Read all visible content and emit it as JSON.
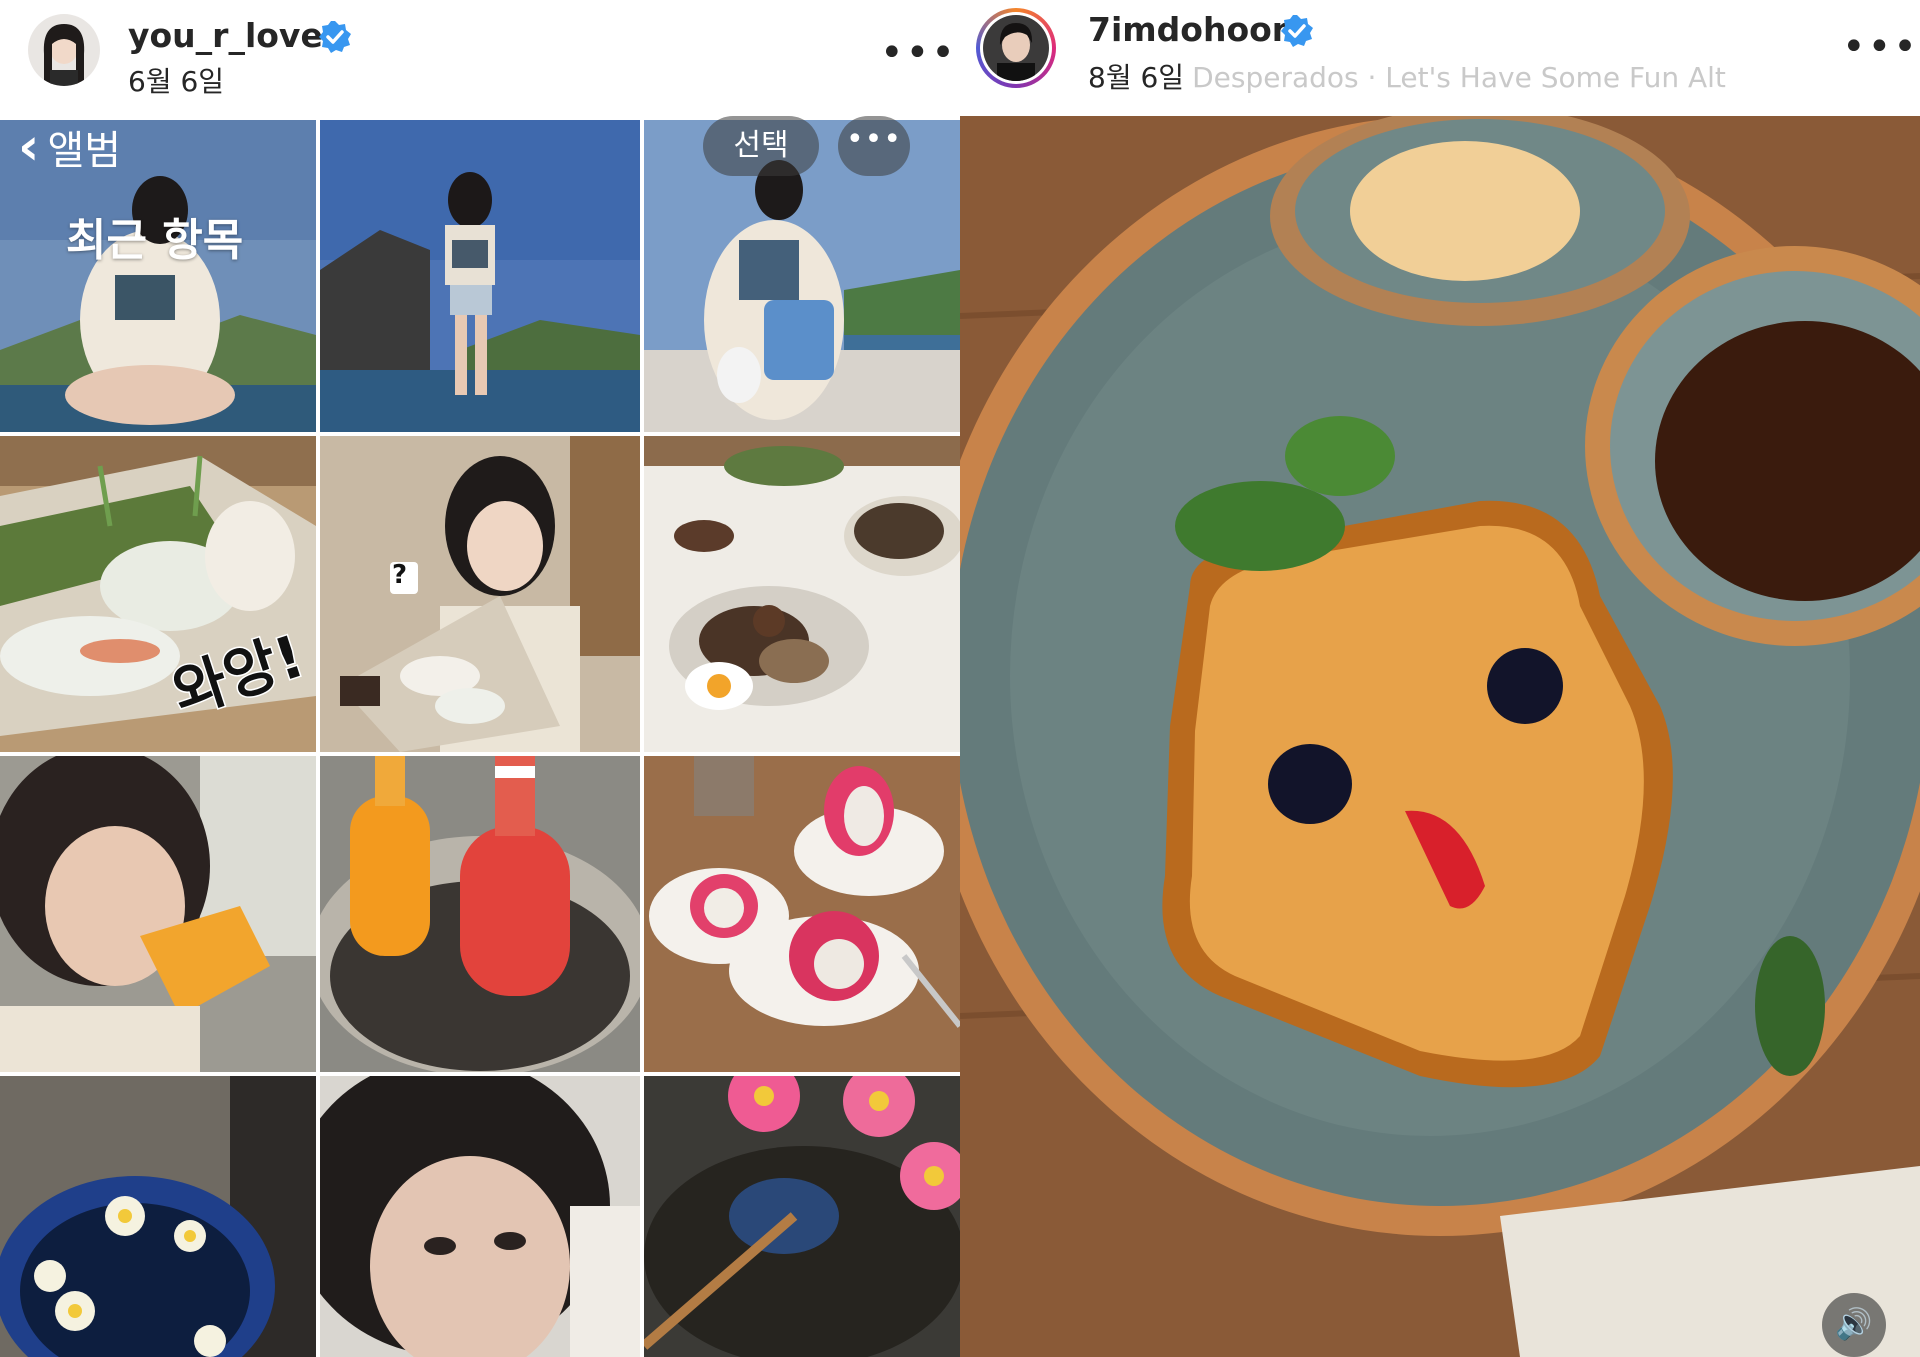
{
  "left_post": {
    "username": "you_r_love",
    "verified_icon": "verified-badge-icon",
    "date": "6월 6일",
    "more_label": "•••",
    "album": {
      "back_label": "앨범",
      "title": "최근 항목",
      "select_label": "선택",
      "more_label": "•••"
    },
    "sticker_text": "와앙!",
    "photos": [
      "pose-by-pool",
      "standing-by-pool",
      "sitting-with-bag",
      "spring-rolls",
      "girl-with-rolls",
      "dinner-table",
      "eating-mango",
      "juice-bottles",
      "dragon-fruit",
      "flower-bowl",
      "selfie-close",
      "flowers-pond"
    ]
  },
  "right_post": {
    "username": "7imdohoon",
    "verified_icon": "verified-badge-icon",
    "date": "8월 6일",
    "music": "Desperados · Let's Have Some Fun Alt",
    "more_label": "•••",
    "sound_icon": "speaker-icon",
    "sound_label": "🔊"
  }
}
